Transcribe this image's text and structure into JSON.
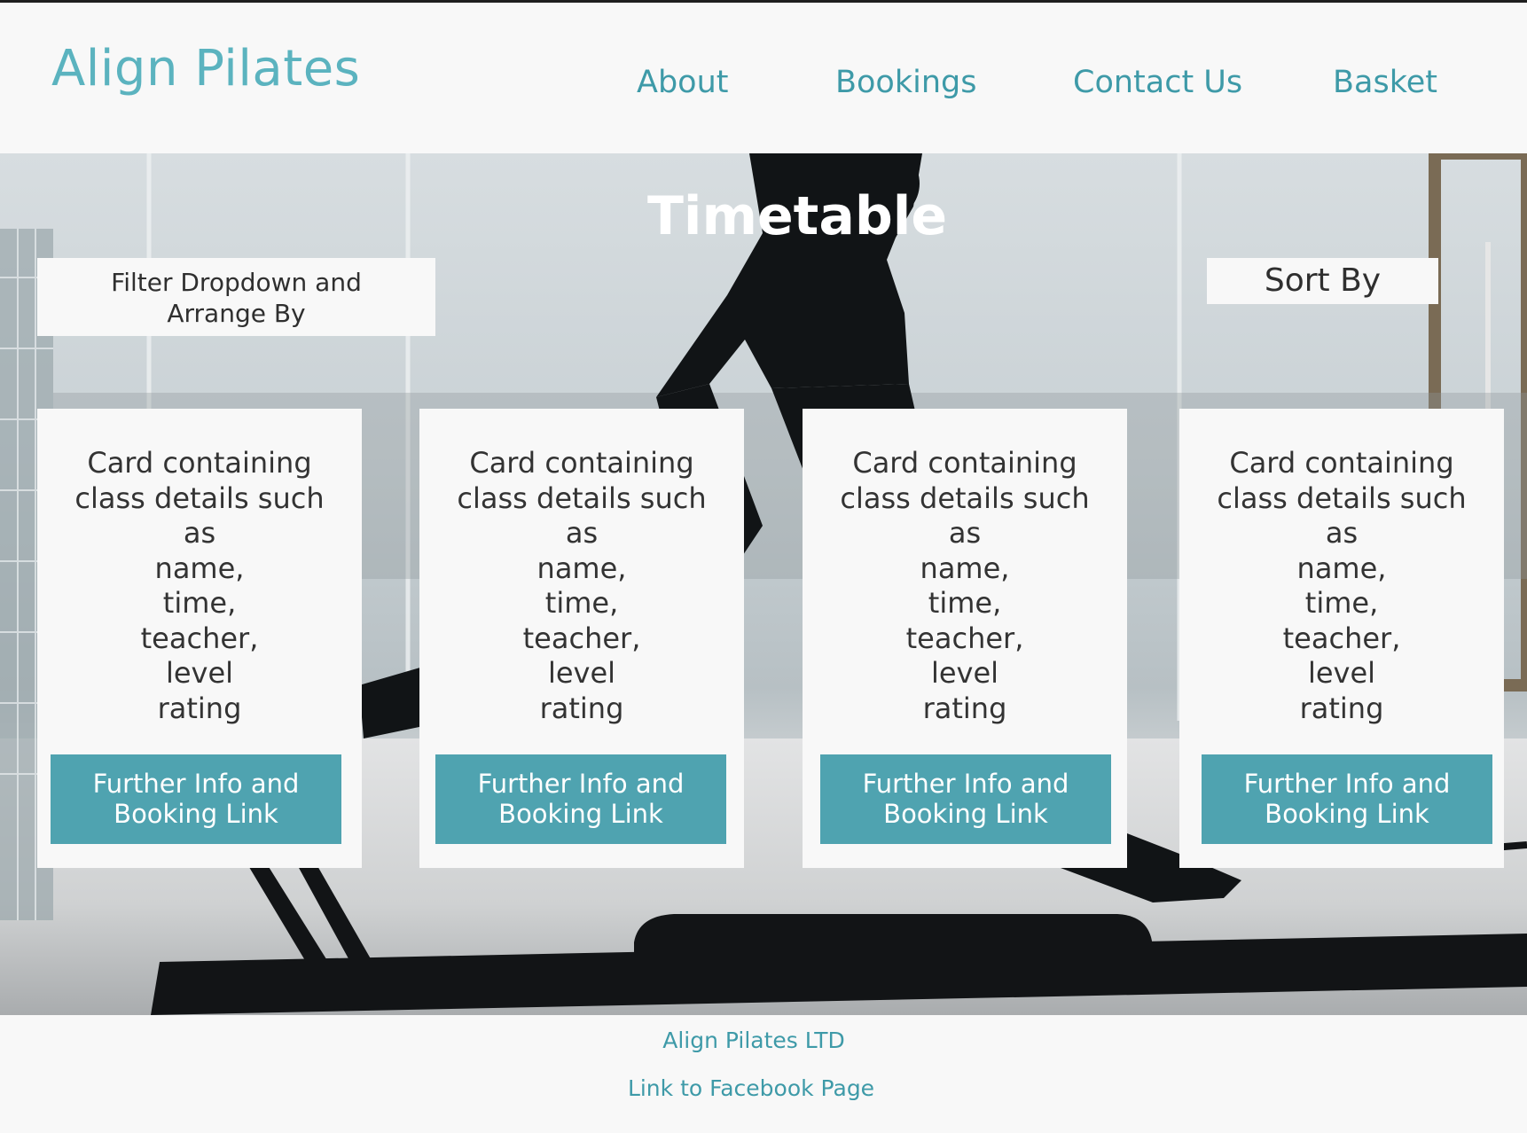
{
  "header": {
    "logo": "Align Pilates",
    "nav": {
      "about": "About",
      "bookings": "Bookings",
      "contact": "Contact Us",
      "basket": "Basket"
    }
  },
  "main": {
    "title": "Timetable",
    "filter_label": "Filter Dropdown and\nArrange By",
    "sort_label": "Sort By",
    "cards": [
      {
        "text": "Card containing\nclass details such\nas\nname,\ntime,\nteacher,\nlevel\nrating",
        "button": "Further Info and\nBooking Link"
      },
      {
        "text": "Card containing\nclass details such\nas\nname,\ntime,\nteacher,\nlevel\nrating",
        "button": "Further Info and\nBooking Link"
      },
      {
        "text": "Card containing\nclass details such\nas\nname,\ntime,\nteacher,\nlevel\nrating",
        "button": "Further Info and\nBooking Link"
      },
      {
        "text": "Card containing\nclass details such\nas\nname,\ntime,\nteacher,\nlevel\nrating",
        "button": "Further Info and\nBooking Link"
      }
    ]
  },
  "footer": {
    "company": "Align Pilates LTD",
    "facebook_link": "Link to Facebook Page"
  },
  "colors": {
    "brand": "#5bb3bf",
    "nav_link": "#3e9aa8",
    "button_bg": "#4fa3b0",
    "page_bg": "#f8f8f8"
  }
}
